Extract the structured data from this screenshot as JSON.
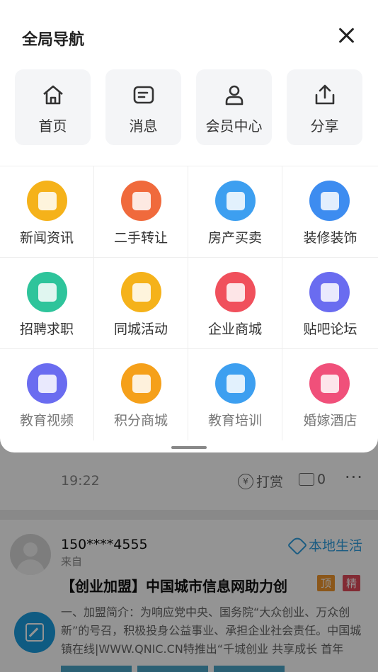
{
  "sheet": {
    "title": "全局导航",
    "quick": [
      {
        "label": "首页",
        "icon": "home-icon"
      },
      {
        "label": "消息",
        "icon": "message-icon"
      },
      {
        "label": "会员中心",
        "icon": "user-icon"
      },
      {
        "label": "分享",
        "icon": "share-icon"
      }
    ],
    "apps": [
      {
        "label": "新闻资讯",
        "icon": "news-icon",
        "color": "#f5b21a"
      },
      {
        "label": "二手转让",
        "icon": "secondhand-icon",
        "color": "#f06a3c"
      },
      {
        "label": "房产买卖",
        "icon": "building-icon",
        "color": "#3d9ff0"
      },
      {
        "label": "装修装饰",
        "icon": "paint-roller-icon",
        "color": "#3d8cf0"
      },
      {
        "label": "招聘求职",
        "icon": "recruit-icon",
        "color": "#2ec49b"
      },
      {
        "label": "同城活动",
        "icon": "gift-icon",
        "color": "#f5b21a"
      },
      {
        "label": "企业商城",
        "icon": "shopping-bag-icon",
        "color": "#f0505c"
      },
      {
        "label": "贴吧论坛",
        "icon": "forum-icon",
        "color": "#6a6cf0"
      },
      {
        "label": "教育视频",
        "icon": "video-icon",
        "color": "#6a6cf0"
      },
      {
        "label": "积分商城",
        "icon": "medal-icon",
        "color": "#f5a01a"
      },
      {
        "label": "教育培训",
        "icon": "graduation-cap-icon",
        "color": "#3d9ff0"
      },
      {
        "label": "婚嫁酒店",
        "icon": "hotel-icon",
        "color": "#f0507a"
      }
    ]
  },
  "feed": {
    "time": "19:22",
    "reward_label": "打赏",
    "reward_icon": "¥",
    "comment_count": "0",
    "more": "···",
    "post": {
      "username": "150****4555",
      "from": "来自",
      "category": "本地生活",
      "title": "【创业加盟】中国城市信息网助力创",
      "badge_top": "顶",
      "badge_fine": "精",
      "body": "一、加盟简介：为响应党中央、国务院“大众创业、万众创新”的号召，积极投身公益事业、承担企业社会责任。中国城镇在线|WWW.QNIC.CN特推出“千城创业 共享成长 首年"
    }
  }
}
